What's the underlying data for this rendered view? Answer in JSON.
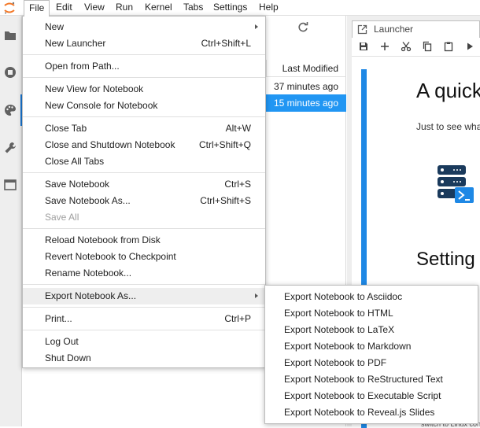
{
  "menubar": {
    "items": [
      "File",
      "Edit",
      "View",
      "Run",
      "Kernel",
      "Tabs",
      "Settings",
      "Help"
    ]
  },
  "file_browser": {
    "column_header": "Last Modified",
    "rows": [
      "37 minutes ago",
      "15 minutes ago"
    ]
  },
  "launcher": {
    "tab_label": "Launcher",
    "heading": "A quick",
    "paragraph": "Just to see wha",
    "heading2": "Setting",
    "footer_fragment": "switch to Linux con"
  },
  "file_menu": {
    "new": "New",
    "new_launcher": "New Launcher",
    "new_launcher_shortcut": "Ctrl+Shift+L",
    "open_from_path": "Open from Path...",
    "new_view": "New View for Notebook",
    "new_console": "New Console for Notebook",
    "close_tab": "Close Tab",
    "close_tab_shortcut": "Alt+W",
    "close_shutdown": "Close and Shutdown Notebook",
    "close_shutdown_shortcut": "Ctrl+Shift+Q",
    "close_all": "Close All Tabs",
    "save": "Save Notebook",
    "save_shortcut": "Ctrl+S",
    "save_as": "Save Notebook As...",
    "save_as_shortcut": "Ctrl+Shift+S",
    "save_all": "Save All",
    "reload": "Reload Notebook from Disk",
    "revert": "Revert Notebook to Checkpoint",
    "rename": "Rename Notebook...",
    "export_as": "Export Notebook As...",
    "print": "Print...",
    "print_shortcut": "Ctrl+P",
    "logout": "Log Out",
    "shutdown": "Shut Down"
  },
  "export_submenu": {
    "items": [
      "Export Notebook to Asciidoc",
      "Export Notebook to HTML",
      "Export Notebook to LaTeX",
      "Export Notebook to Markdown",
      "Export Notebook to PDF",
      "Export Notebook to ReStructured Text",
      "Export Notebook to Executable Script",
      "Export Notebook to Reveal.js Slides"
    ]
  },
  "colors": {
    "accent": "#2196f3",
    "jupyter_orange": "#f37726"
  }
}
